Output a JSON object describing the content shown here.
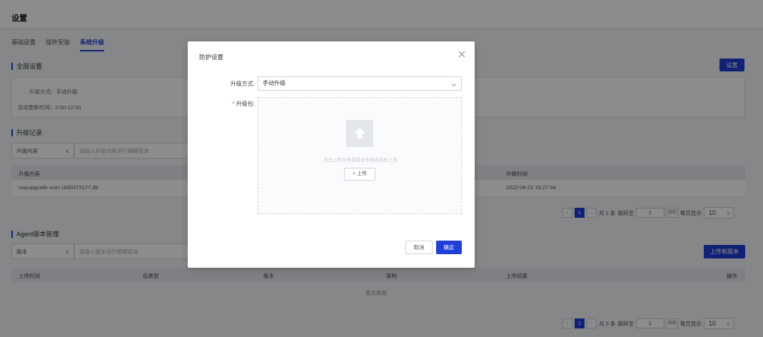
{
  "page": {
    "title": "设置",
    "tabs": [
      {
        "label": "基础设置"
      },
      {
        "label": "插件安装"
      },
      {
        "label": "系统升级"
      }
    ]
  },
  "global_settings": {
    "title": "全局设置",
    "settings_button": "设置",
    "upgrade_mode_line": "升级方式：手动升级",
    "auto_update_line": "自动更新时间：0:00-12:00"
  },
  "upgrade_records": {
    "title": "升级记录",
    "filter_select": "升级内容",
    "search_placeholder": "请输入升级内容进行模糊查询",
    "columns": [
      "升级内容",
      "升级时间"
    ],
    "rows": [
      {
        "content": "cwpupgrade-vuln-1660372177.db",
        "time": "2022-08-22 15:27:34"
      }
    ],
    "pagination": {
      "current_page": "1",
      "total": "共 1 条",
      "jump_label": "跳转至",
      "jump_value": "1",
      "go": "GO",
      "per_page_label": "每页显示",
      "per_page": "10"
    }
  },
  "agent_versions": {
    "title": "Agent版本管理",
    "filter_select": "版本",
    "search_placeholder": "请输入版本进行模糊查询",
    "upload_button": "上传新版本",
    "columns": [
      "上传时间",
      "包类型",
      "版本",
      "架构",
      "上传结果",
      "操作"
    ],
    "empty_text": "暂无数据",
    "pagination": {
      "current_page": "1",
      "total": "共 0 条",
      "jump_label": "跳转至",
      "jump_value": "1",
      "go": "GO",
      "per_page_label": "每页显示",
      "per_page": "10"
    }
  },
  "modal": {
    "title": "防护设置",
    "upgrade_mode_label": "升级方式:",
    "upgrade_mode_value": "手动升级",
    "package_label": "升级包:",
    "required_mark": "*",
    "upload_hint": "点击上传文件或将文件拖到此处上传",
    "upload_button": "+ 上传",
    "cancel_button": "取消",
    "ok_button": "确定"
  },
  "colors": {
    "accent": "#1f3fd8",
    "required": "#e34d59"
  }
}
